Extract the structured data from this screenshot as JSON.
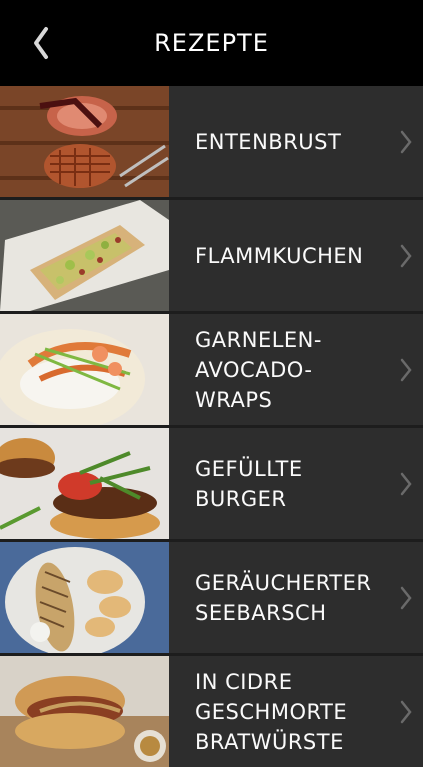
{
  "header": {
    "title": "REZEPTE",
    "back_icon": "chevron-left-icon"
  },
  "recipes": [
    {
      "lines": [
        "ENTENBRUST"
      ],
      "image": "duck-breast-photo"
    },
    {
      "lines": [
        "FLAMMKUCHEN"
      ],
      "image": "flammkuchen-photo"
    },
    {
      "lines": [
        "GARNELEN-",
        "AVOCADO-WRAPS"
      ],
      "image": "shrimp-wrap-photo"
    },
    {
      "lines": [
        "GEFÜLLTE BURGER"
      ],
      "image": "burger-photo"
    },
    {
      "lines": [
        "GERÄUCHERTER",
        "SEEBARSCH"
      ],
      "image": "smoked-fish-photo"
    },
    {
      "lines": [
        "IN CIDRE",
        "GESCHMORTE",
        "BRATWÜRSTE"
      ],
      "image": "bratwurst-photo"
    }
  ],
  "colors": {
    "header_bg": "#000000",
    "row_bg": "#2d2d2d",
    "separator": "#1d1d1d",
    "chevron": "#6a6a6a"
  }
}
